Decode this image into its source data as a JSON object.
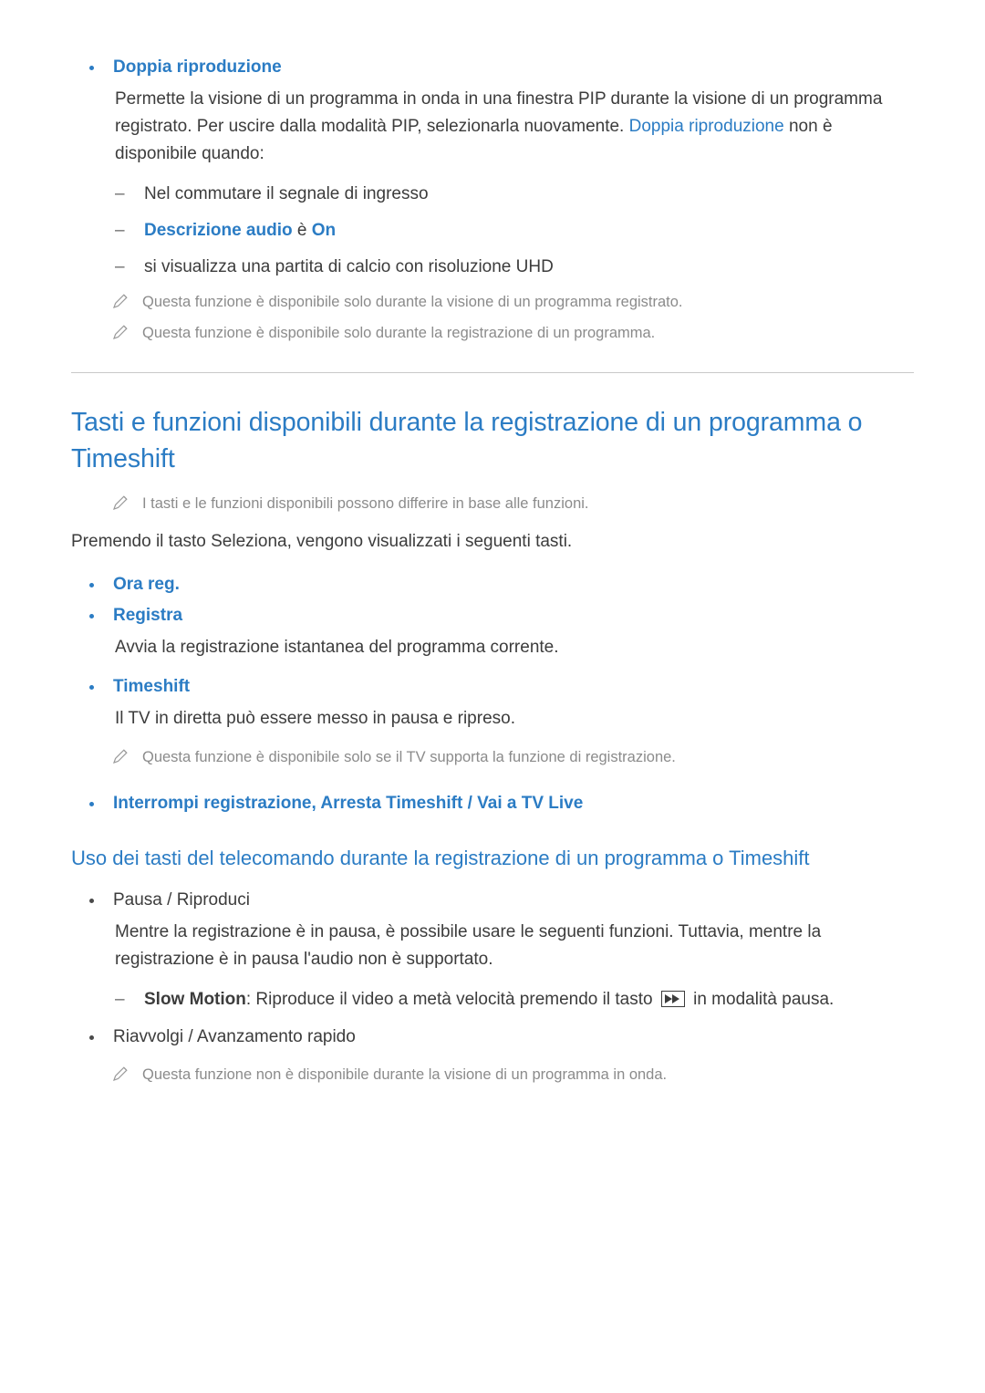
{
  "section1": {
    "heading": "Doppia riproduzione",
    "paragraph_part1": "Permette la visione di un programma in onda in una finestra PIP durante la visione di un programma registrato. Per uscire dalla modalità PIP, selezionarla nuovamente. ",
    "paragraph_link": "Doppia riproduzione",
    "paragraph_part2": " non è disponibile quando:",
    "dash1": "Nel commutare il segnale di ingresso",
    "dash2_link": "Descrizione audio",
    "dash2_mid": " è ",
    "dash2_value": "On",
    "dash3": "si visualizza una partita di calcio con risoluzione UHD",
    "note1": "Questa funzione è disponibile solo durante la visione di un programma registrato.",
    "note2": "Questa funzione è disponibile solo durante la registrazione di un programma."
  },
  "section2": {
    "title": "Tasti e funzioni disponibili durante la registrazione di un programma o Timeshift",
    "note1": "I tasti e le funzioni disponibili possono differire in base alle funzioni.",
    "intro": "Premendo il tasto Seleziona, vengono visualizzati i seguenti tasti.",
    "bullet1": "Ora reg.",
    "bullet2": "Registra",
    "bullet2_body": "Avvia la registrazione istantanea del programma corrente.",
    "bullet3": "Timeshift",
    "bullet3_body": "Il TV in diretta può essere messo in pausa e ripreso.",
    "note2": "Questa funzione è disponibile solo se il TV supporta la funzione di registrazione.",
    "bullet4_a": "Interrompi registrazione",
    "bullet4_sep1": ", ",
    "bullet4_b": "Arresta Timeshift",
    "bullet4_sep2": " / ",
    "bullet4_c": "Vai a TV Live"
  },
  "section3": {
    "title": "Uso dei tasti del telecomando durante la registrazione di un programma o Timeshift",
    "bullet1": "Pausa / Riproduci",
    "bullet1_body": "Mentre la registrazione è in pausa, è possibile usare le seguenti funzioni. Tuttavia, mentre la registrazione è in pausa l'audio non è supportato.",
    "dash1_label": "Slow Motion",
    "dash1_part1": ": Riproduce il video a metà velocità premendo il tasto ",
    "dash1_icon": "fast-forward-icon",
    "dash1_part2": " in modalità pausa.",
    "bullet2": "Riavvolgi / Avanzamento rapido",
    "note1": "Questa funzione non è disponibile durante la visione di un programma in onda."
  },
  "colors": {
    "accent": "#2b7cc4",
    "body": "#3c3c3c",
    "note": "#8b8b8b",
    "rule": "#c9c9c9"
  }
}
